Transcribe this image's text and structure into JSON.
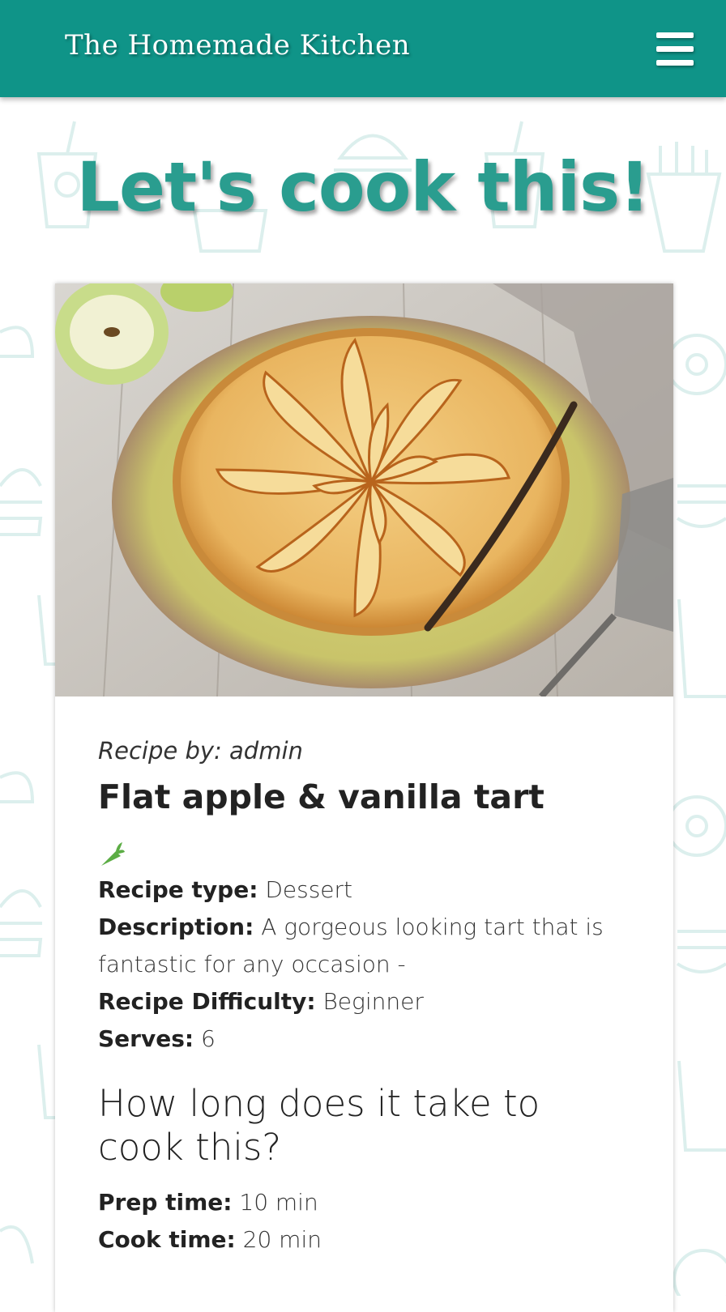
{
  "header": {
    "brand": "The Homemade Kitchen"
  },
  "page": {
    "heading": "Let's cook this!"
  },
  "recipe": {
    "author_line": "Recipe by: admin",
    "title": "Flat apple & vanilla tart",
    "diet_icon": "carrot-icon",
    "type_label": "Recipe type:",
    "type_value": "Dessert",
    "description_label": "Description:",
    "description_value": "A gorgeous looking tart that is fantastic for any occasion -",
    "difficulty_label": "Recipe Difficulty:",
    "difficulty_value": "Beginner",
    "serves_label": "Serves:",
    "serves_value": "6",
    "time_heading": "How long does it take to cook this?",
    "prep_label": "Prep time:",
    "prep_value": "10 min",
    "cook_label": "Cook time:",
    "cook_value": "20 min"
  },
  "colors": {
    "brand": "#0f9488",
    "heading": "#2a9d8f",
    "pattern": "#d9efec"
  }
}
